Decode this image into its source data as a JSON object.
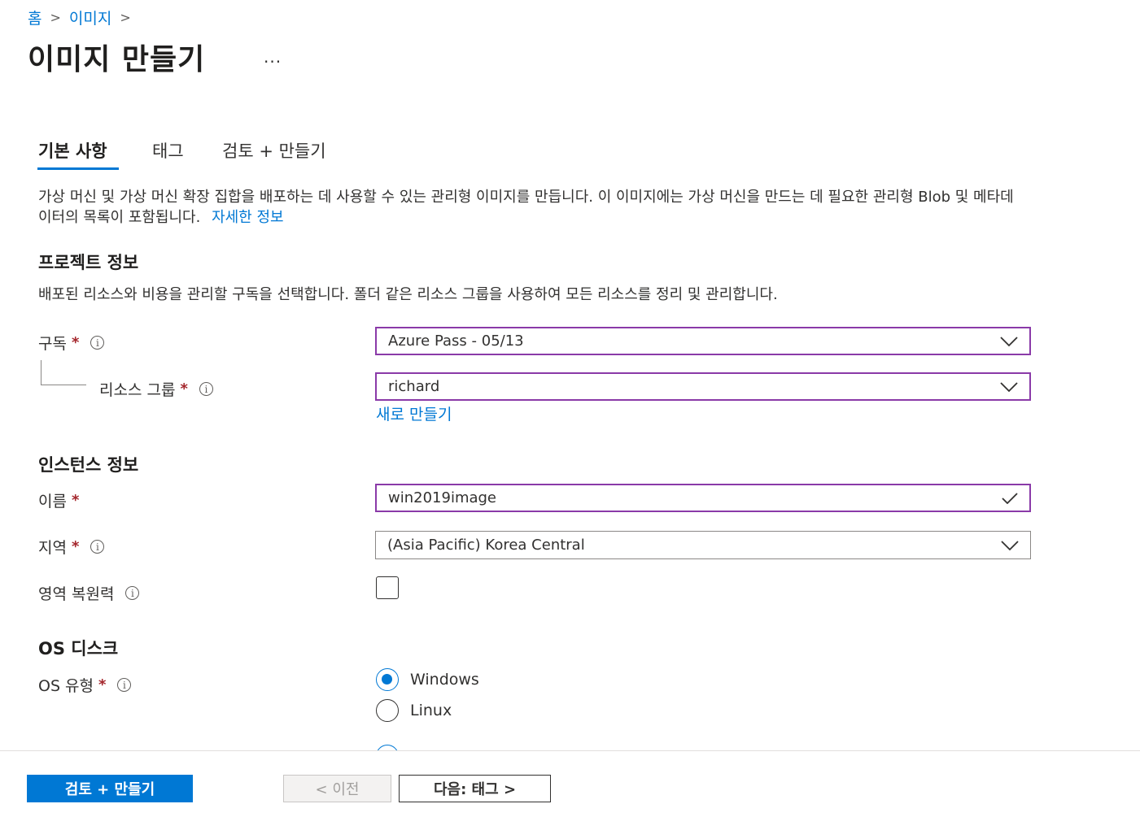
{
  "breadcrumb": {
    "home": "홈",
    "images": "이미지"
  },
  "page": {
    "title": "이미지 만들기",
    "more": "..."
  },
  "tabs": [
    {
      "label": "기본 사항"
    },
    {
      "label": "태그"
    },
    {
      "label": "검토 + 만들기"
    }
  ],
  "intro": {
    "text": "가상 머신 및 가상 머신 확장 집합을 배포하는 데 사용할 수 있는 관리형 이미지를 만듭니다. 이 이미지에는 가상 머신을 만드는 데 필요한 관리형 Blob 및 메타데이터의 목록이 포함됩니다.",
    "link": "자세한 정보"
  },
  "project": {
    "heading": "프로젝트 정보",
    "desc": "배포된 리소스와 비용을 관리할 구독을 선택합니다. 폴더 같은 리소스 그룹을 사용하여 모든 리소스를 정리 및 관리합니다.",
    "subscription_label": "구독",
    "subscription_value": "Azure Pass - 05/13",
    "resource_group_label": "리소스 그룹",
    "resource_group_value": "richard",
    "create_new": "새로 만들기"
  },
  "instance": {
    "heading": "인스턴스 정보",
    "name_label": "이름",
    "name_value": "win2019image",
    "region_label": "지역",
    "region_value": "(Asia Pacific) Korea Central",
    "zone_label": "영역 복원력",
    "zone_checked": false
  },
  "os": {
    "heading": "OS 디스크",
    "type_label": "OS 유형",
    "options": [
      "Windows",
      "Linux"
    ],
    "selected": "Windows"
  },
  "footer": {
    "review_button": "검토 + 만들기",
    "prev_button": "< 이전",
    "next_button": "다음: 태그 >"
  },
  "colors": {
    "accent": "#0078d4",
    "focus_border": "#8a3aa8",
    "required": "#a4262c"
  }
}
